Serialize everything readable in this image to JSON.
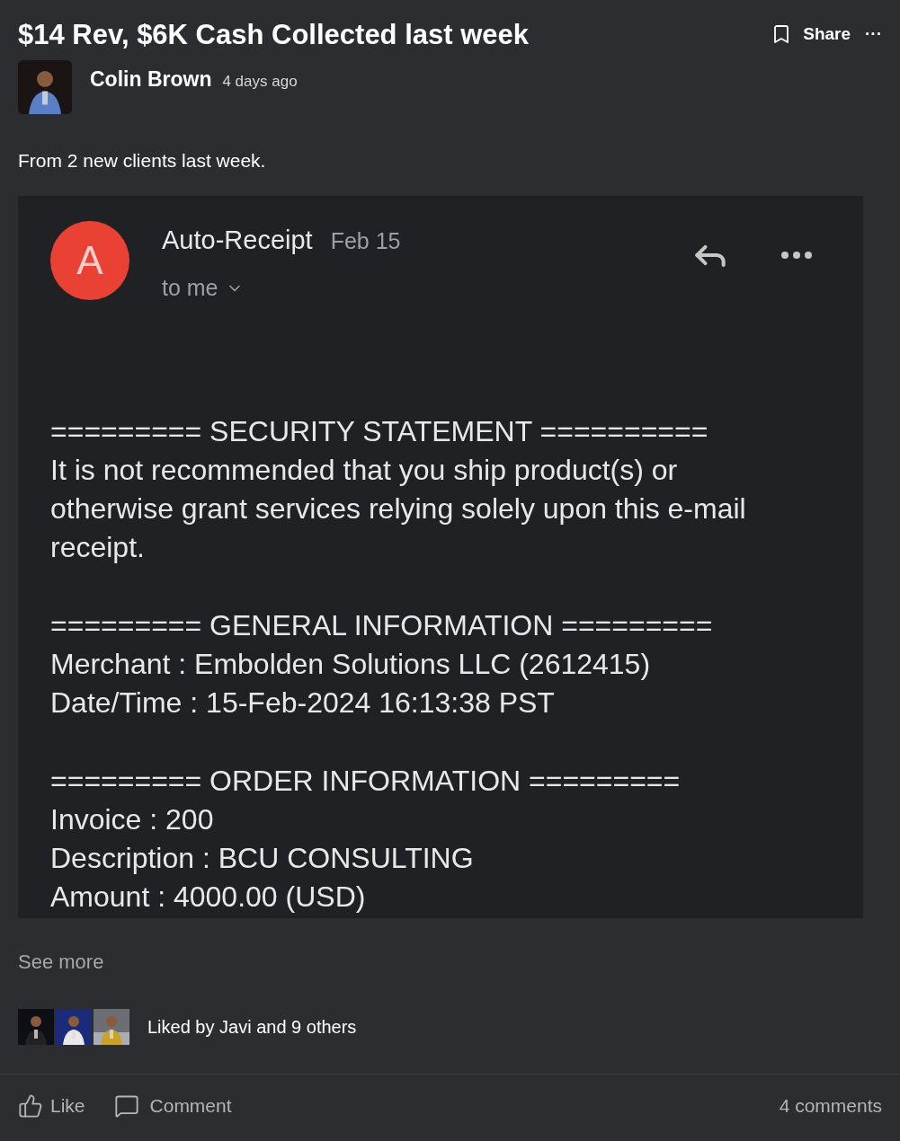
{
  "post": {
    "title": "$14 Rev, $6K Cash Collected last week",
    "author": "Colin Brown",
    "time": "4 days ago",
    "body": "From 2 new clients last week."
  },
  "actions_top": {
    "share": "Share",
    "more": "···"
  },
  "email": {
    "avatar_letter": "A",
    "sender": "Auto-Receipt",
    "date": "Feb 15",
    "recipient": "to me",
    "sections": [
      {
        "heading": "========= SECURITY STATEMENT ==========",
        "lines": [
          "It is not recommended that you ship product(s) or otherwise grant services relying solely upon this e-mail receipt."
        ]
      },
      {
        "heading": "========= GENERAL INFORMATION =========",
        "lines": [
          "Merchant : Embolden Solutions LLC (2612415)",
          "Date/Time : 15-Feb-2024 16:13:38 PST"
        ]
      },
      {
        "heading": "========= ORDER INFORMATION =========",
        "lines": [
          "Invoice : 200",
          "Description : BCU CONSULTING",
          "Amount : 4000.00 (USD)"
        ]
      }
    ]
  },
  "see_more": "See more",
  "likes": {
    "text": "Liked by Javi and 9 others"
  },
  "footer": {
    "like": "Like",
    "comment": "Comment",
    "comments_count": "4 comments"
  }
}
